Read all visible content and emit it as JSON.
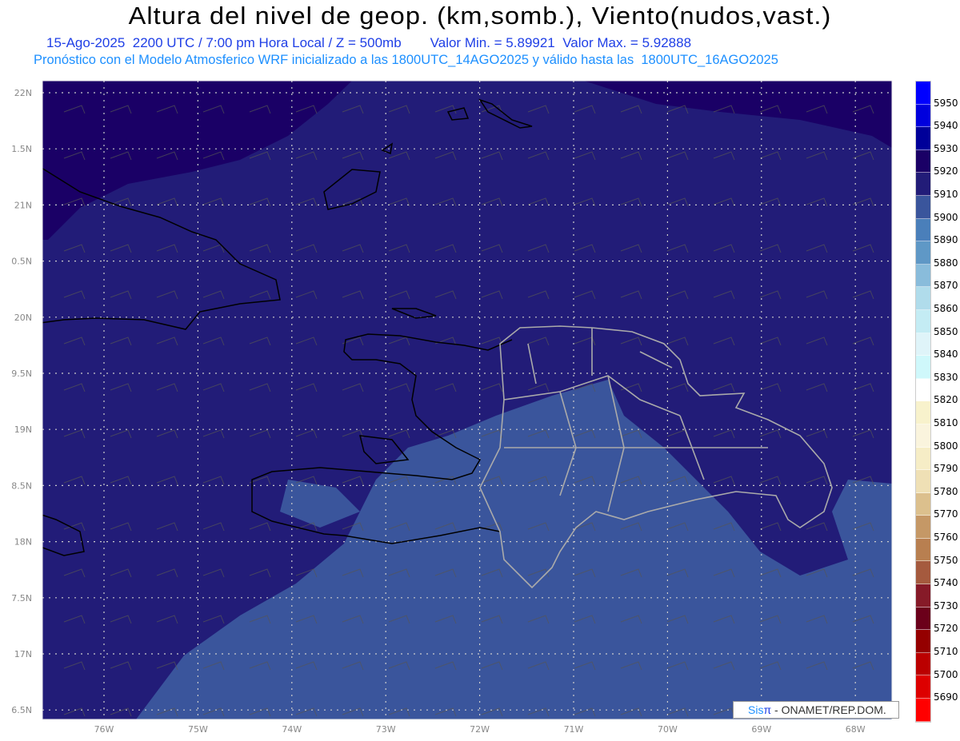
{
  "header": {
    "title": "Altura del nivel de geop. (km,somb.), Viento(nudos,vast.)",
    "datetime": "15-Ago-2025  2200 UTC / 7:00 pm Hora Local / Z = 500mb",
    "min_max": "Valor Min. = 5.89921  Valor Max. = 5.92888",
    "forecast_info": "Pronóstico con el Modelo Atmosferico WRF inicializado a las 1800UTC_14AGO2025 y válido hasta las  1800UTC_16AGO2025"
  },
  "map": {
    "lon_labels": [
      "76W",
      "75W",
      "74W",
      "73W",
      "72W",
      "71W",
      "70W",
      "69W",
      "68W"
    ],
    "lat_labels": [
      "22N",
      "1.5N",
      "21N",
      "0.5N",
      "20N",
      "9.5N",
      "19N",
      "8.5N",
      "18N",
      "7.5N",
      "17N",
      "6.5N"
    ],
    "fill_colors": {
      "dark": "#1a0066",
      "mid": "#221c78",
      "light": "#3a559c",
      "lighter": "#4a7fba"
    }
  },
  "colorbar": {
    "labels": [
      "5950",
      "5940",
      "5930",
      "5920",
      "5910",
      "5900",
      "5890",
      "5880",
      "5870",
      "5860",
      "5850",
      "5840",
      "5830",
      "5820",
      "5810",
      "5800",
      "5790",
      "5780",
      "5770",
      "5760",
      "5750",
      "5740",
      "5730",
      "5720",
      "5710",
      "5700",
      "5690"
    ],
    "colors": [
      "#0000ff",
      "#0000dd",
      "#000099",
      "#1a0066",
      "#221c78",
      "#3a559c",
      "#4a7fba",
      "#5f98c6",
      "#89bcdb",
      "#b0dceb",
      "#c4ecf4",
      "#dff4f9",
      "#cff8fb",
      "#ffffff",
      "#f8f2cc",
      "#faf4dd",
      "#f6edc6",
      "#efe0b5",
      "#dcc08d",
      "#c59866",
      "#b87f50",
      "#a55a3e",
      "#861a28",
      "#6b001a",
      "#950000",
      "#bb0000",
      "#dd0000",
      "#ff0000"
    ]
  },
  "credit": {
    "brand_a": "Sis",
    "brand_b": "π",
    "text": " - ONAMET/REP.DOM."
  }
}
